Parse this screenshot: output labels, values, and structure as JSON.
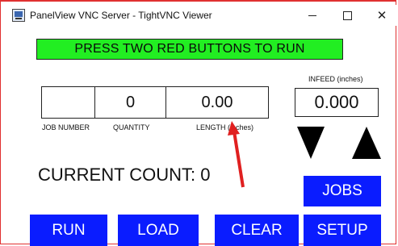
{
  "window": {
    "title": "PanelView VNC Server - TightVNC Viewer",
    "app_icon": "vnc-viewer-icon"
  },
  "hmi": {
    "banner": "PRESS TWO RED BUTTONS TO RUN",
    "fields": {
      "job_number": {
        "value": "",
        "label": "JOB NUMBER"
      },
      "quantity": {
        "value": "0",
        "label": "QUANTITY"
      },
      "length": {
        "value": "0.00",
        "label": "LENGTH (inches)"
      },
      "infeed": {
        "value": "0.000",
        "label": "INFEED (inches)"
      }
    },
    "current_count": "CURRENT COUNT: 0",
    "buttons": {
      "jobs": "JOBS",
      "run": "RUN",
      "load": "LOAD",
      "clear": "CLEAR",
      "setup": "SETUP"
    },
    "colors": {
      "banner_bg": "#22ee22",
      "button_bg": "#0a1cff",
      "annotation_arrow": "#e02020"
    }
  }
}
